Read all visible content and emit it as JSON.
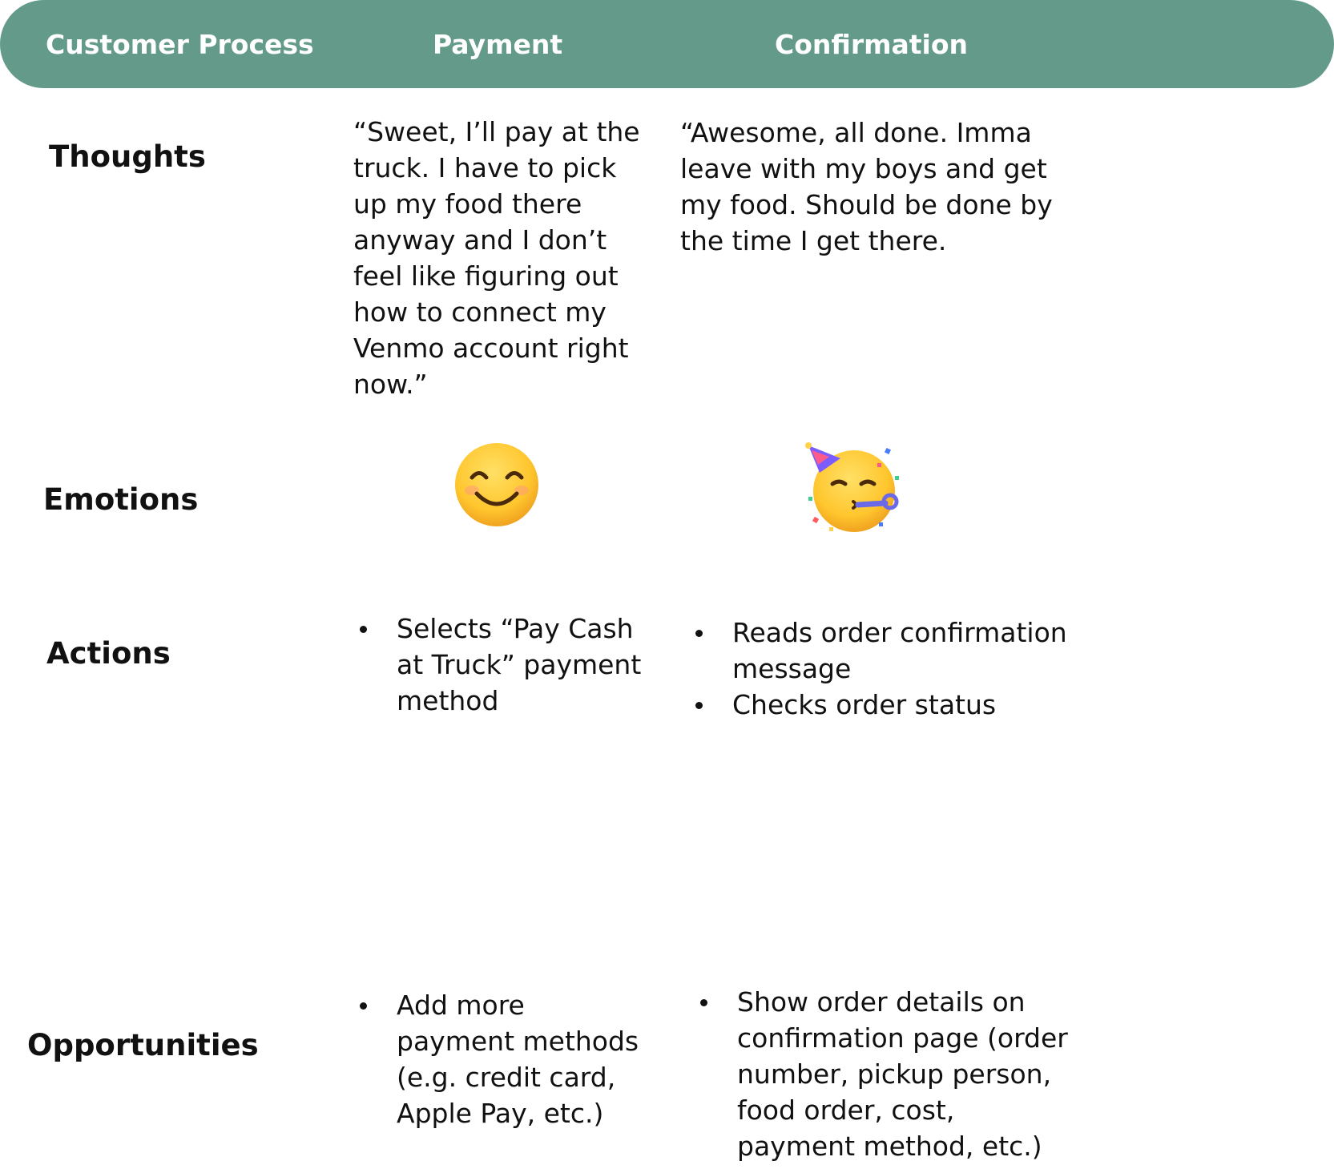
{
  "header": {
    "col_process": "Customer Process",
    "col_payment": "Payment",
    "col_confirmation": "Confirmation",
    "bar_color": "#639a89"
  },
  "rows": {
    "thoughts": {
      "label": "Thoughts",
      "payment": "“Sweet, I’ll pay at the truck. I have to pick up my food there anyway and I don’t feel like figuring out how to connect my Venmo account right now.”",
      "confirmation": "“Awesome, all done. Imma leave with my boys and get my food. Should be done by the time I get there."
    },
    "emotions": {
      "label": "Emotions",
      "payment_icon": "smiling-face-icon",
      "confirmation_icon": "partying-face-icon"
    },
    "actions": {
      "label": "Actions",
      "payment": [
        "Selects “Pay Cash at Truck” payment method"
      ],
      "confirmation": [
        "Reads order confirmation message",
        "Checks order status"
      ]
    },
    "opportunities": {
      "label": "Opportunities",
      "payment": [
        "Add more payment methods (e.g. credit card, Apple Pay, etc.)"
      ],
      "confirmation": [
        "Show order details on confirmation page (order number, pickup person, food order, cost, payment method, etc.)"
      ]
    }
  }
}
